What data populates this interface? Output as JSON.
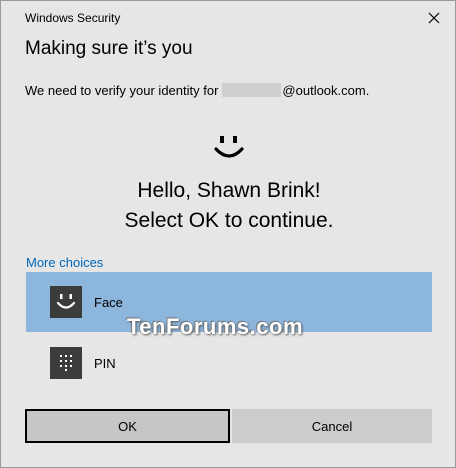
{
  "window": {
    "title": "Windows Security",
    "close_icon": "close-icon"
  },
  "heading": "Making sure it’s you",
  "prompt": {
    "before": "We need to verify your identity for",
    "after": "@outlook.com."
  },
  "greeting": {
    "line1": "Hello, Shawn Brink!",
    "line2": "Select OK to continue."
  },
  "more_choices": "More choices",
  "options": [
    {
      "label": "Face",
      "icon": "face-icon",
      "selected": true
    },
    {
      "label": "PIN",
      "icon": "pin-keypad-icon",
      "selected": false
    }
  ],
  "watermark": "TenForums.com",
  "buttons": {
    "ok": "OK",
    "cancel": "Cancel"
  },
  "colors": {
    "background": "#e6e6e6",
    "selected_option": "#8db6dd",
    "link": "#0067b8",
    "icon_tile": "#3c3c3c"
  }
}
